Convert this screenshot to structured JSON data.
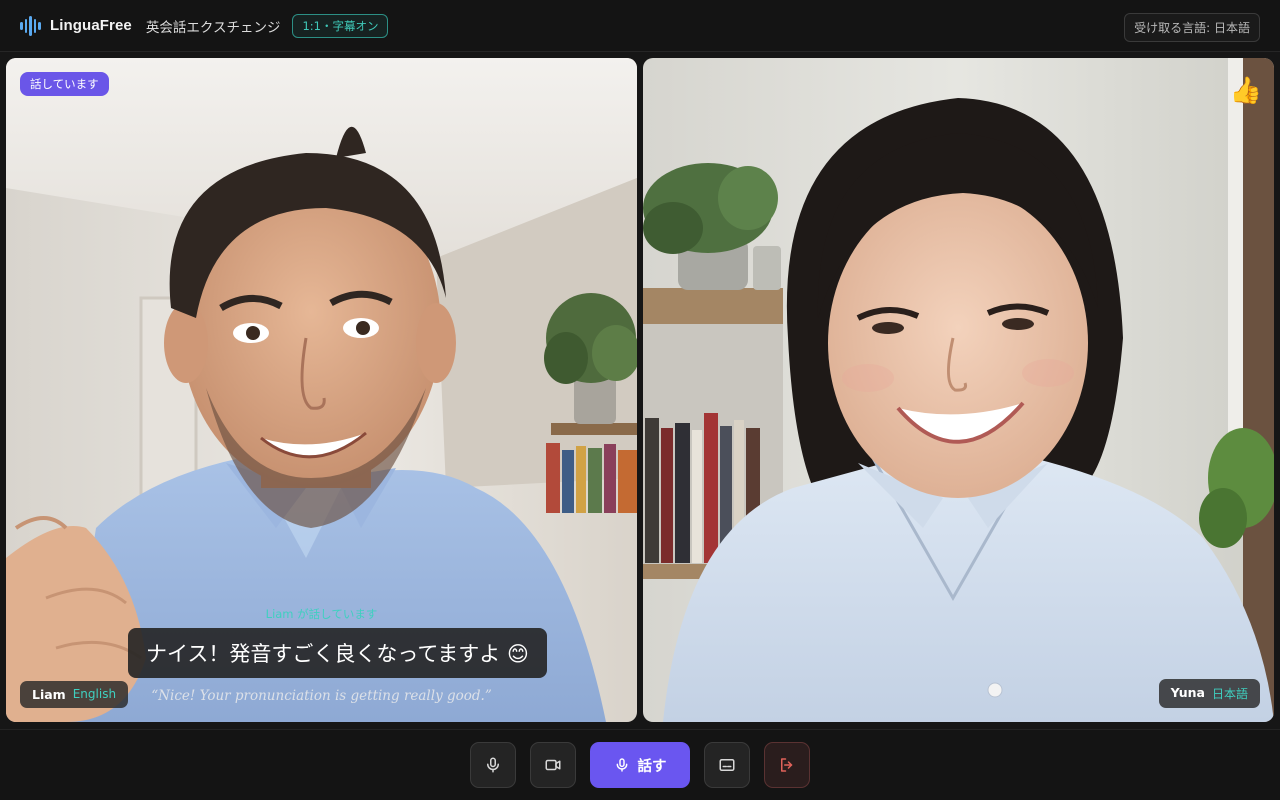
{
  "app": {
    "name": "LinguaFree",
    "session_title": "英会話エクスチェンジ",
    "session_badge": "1:1・字幕オン",
    "receive_language": "受け取る言語: 日本語"
  },
  "participants": [
    {
      "name": "Liam",
      "language": "English",
      "status_badge": "話しています"
    },
    {
      "name": "Yuna",
      "language": "日本語",
      "reaction": "👍"
    }
  ],
  "caption": {
    "speaker_line": "Liam が話しています",
    "text": "ナイス！発音すごく良くなってますよ 😊",
    "translation": "“Nice! Your pronunciation is getting really good.”"
  },
  "controls": {
    "talk_label": "話す",
    "icons": [
      "microphone-icon",
      "camera-icon",
      "captions-icon",
      "leave-icon"
    ]
  },
  "colors": {
    "accent": "#6a56f0",
    "teal": "#3fd0c0",
    "danger": "#e0625a",
    "background": "#161616"
  }
}
